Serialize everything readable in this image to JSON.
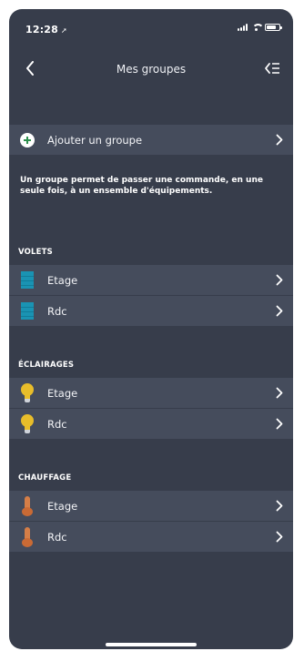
{
  "status_bar": {
    "time": "12:28",
    "location_glyph": "➚",
    "signal_icon": "cellular-signal-icon",
    "wifi_icon": "wifi-icon",
    "battery_icon": "battery-icon",
    "battery_level": 0.8
  },
  "nav": {
    "title": "Mes groupes",
    "back_icon": "chevron-left-icon",
    "action_icon": "reorder-list-icon"
  },
  "add_group": {
    "label": "Ajouter un groupe",
    "icon": "plus-circle-icon",
    "icon_color": "#2e8f4e"
  },
  "description": "Un groupe permet de passer une commande, en une seule fois, à un ensemble d'équipements.",
  "sections": [
    {
      "title": "VOLETS",
      "icon": "shutter-icon",
      "color": "#1a93b3",
      "items": [
        {
          "label": "Etage"
        },
        {
          "label": "Rdc"
        }
      ]
    },
    {
      "title": "ÉCLAIRAGES",
      "icon": "light-bulb-icon",
      "color": "#e8bd2a",
      "items": [
        {
          "label": "Etage"
        },
        {
          "label": "Rdc"
        }
      ]
    },
    {
      "title": "CHAUFFAGE",
      "icon": "thermometer-icon",
      "color": "#d57e47",
      "items": [
        {
          "label": "Etage"
        },
        {
          "label": "Rdc"
        }
      ]
    }
  ],
  "colors": {
    "background": "#373d4b",
    "row_background": "#454c5c",
    "text": "#ffffff"
  }
}
